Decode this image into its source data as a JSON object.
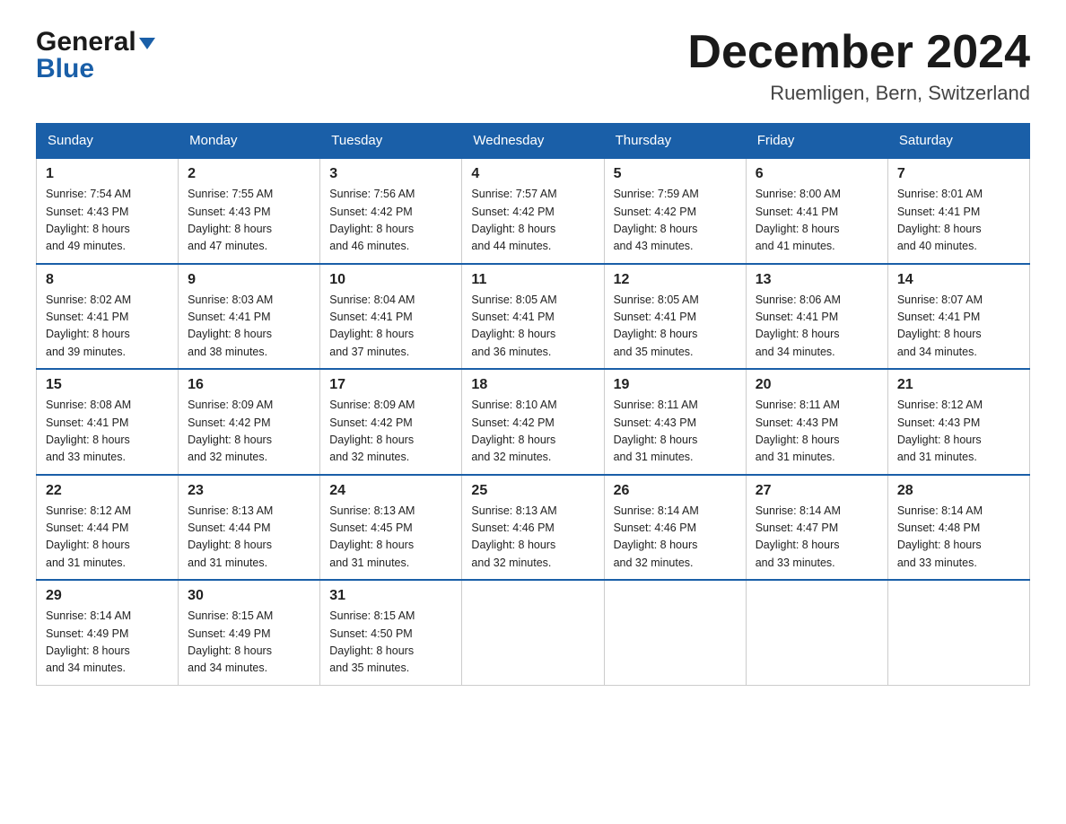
{
  "header": {
    "logo_general": "General",
    "logo_blue": "Blue",
    "month_title": "December 2024",
    "location": "Ruemligen, Bern, Switzerland"
  },
  "days_of_week": [
    "Sunday",
    "Monday",
    "Tuesday",
    "Wednesday",
    "Thursday",
    "Friday",
    "Saturday"
  ],
  "weeks": [
    [
      {
        "day": "1",
        "sunrise": "Sunrise: 7:54 AM",
        "sunset": "Sunset: 4:43 PM",
        "daylight": "Daylight: 8 hours and 49 minutes."
      },
      {
        "day": "2",
        "sunrise": "Sunrise: 7:55 AM",
        "sunset": "Sunset: 4:43 PM",
        "daylight": "Daylight: 8 hours and 47 minutes."
      },
      {
        "day": "3",
        "sunrise": "Sunrise: 7:56 AM",
        "sunset": "Sunset: 4:42 PM",
        "daylight": "Daylight: 8 hours and 46 minutes."
      },
      {
        "day": "4",
        "sunrise": "Sunrise: 7:57 AM",
        "sunset": "Sunset: 4:42 PM",
        "daylight": "Daylight: 8 hours and 44 minutes."
      },
      {
        "day": "5",
        "sunrise": "Sunrise: 7:59 AM",
        "sunset": "Sunset: 4:42 PM",
        "daylight": "Daylight: 8 hours and 43 minutes."
      },
      {
        "day": "6",
        "sunrise": "Sunrise: 8:00 AM",
        "sunset": "Sunset: 4:41 PM",
        "daylight": "Daylight: 8 hours and 41 minutes."
      },
      {
        "day": "7",
        "sunrise": "Sunrise: 8:01 AM",
        "sunset": "Sunset: 4:41 PM",
        "daylight": "Daylight: 8 hours and 40 minutes."
      }
    ],
    [
      {
        "day": "8",
        "sunrise": "Sunrise: 8:02 AM",
        "sunset": "Sunset: 4:41 PM",
        "daylight": "Daylight: 8 hours and 39 minutes."
      },
      {
        "day": "9",
        "sunrise": "Sunrise: 8:03 AM",
        "sunset": "Sunset: 4:41 PM",
        "daylight": "Daylight: 8 hours and 38 minutes."
      },
      {
        "day": "10",
        "sunrise": "Sunrise: 8:04 AM",
        "sunset": "Sunset: 4:41 PM",
        "daylight": "Daylight: 8 hours and 37 minutes."
      },
      {
        "day": "11",
        "sunrise": "Sunrise: 8:05 AM",
        "sunset": "Sunset: 4:41 PM",
        "daylight": "Daylight: 8 hours and 36 minutes."
      },
      {
        "day": "12",
        "sunrise": "Sunrise: 8:05 AM",
        "sunset": "Sunset: 4:41 PM",
        "daylight": "Daylight: 8 hours and 35 minutes."
      },
      {
        "day": "13",
        "sunrise": "Sunrise: 8:06 AM",
        "sunset": "Sunset: 4:41 PM",
        "daylight": "Daylight: 8 hours and 34 minutes."
      },
      {
        "day": "14",
        "sunrise": "Sunrise: 8:07 AM",
        "sunset": "Sunset: 4:41 PM",
        "daylight": "Daylight: 8 hours and 34 minutes."
      }
    ],
    [
      {
        "day": "15",
        "sunrise": "Sunrise: 8:08 AM",
        "sunset": "Sunset: 4:41 PM",
        "daylight": "Daylight: 8 hours and 33 minutes."
      },
      {
        "day": "16",
        "sunrise": "Sunrise: 8:09 AM",
        "sunset": "Sunset: 4:42 PM",
        "daylight": "Daylight: 8 hours and 32 minutes."
      },
      {
        "day": "17",
        "sunrise": "Sunrise: 8:09 AM",
        "sunset": "Sunset: 4:42 PM",
        "daylight": "Daylight: 8 hours and 32 minutes."
      },
      {
        "day": "18",
        "sunrise": "Sunrise: 8:10 AM",
        "sunset": "Sunset: 4:42 PM",
        "daylight": "Daylight: 8 hours and 32 minutes."
      },
      {
        "day": "19",
        "sunrise": "Sunrise: 8:11 AM",
        "sunset": "Sunset: 4:43 PM",
        "daylight": "Daylight: 8 hours and 31 minutes."
      },
      {
        "day": "20",
        "sunrise": "Sunrise: 8:11 AM",
        "sunset": "Sunset: 4:43 PM",
        "daylight": "Daylight: 8 hours and 31 minutes."
      },
      {
        "day": "21",
        "sunrise": "Sunrise: 8:12 AM",
        "sunset": "Sunset: 4:43 PM",
        "daylight": "Daylight: 8 hours and 31 minutes."
      }
    ],
    [
      {
        "day": "22",
        "sunrise": "Sunrise: 8:12 AM",
        "sunset": "Sunset: 4:44 PM",
        "daylight": "Daylight: 8 hours and 31 minutes."
      },
      {
        "day": "23",
        "sunrise": "Sunrise: 8:13 AM",
        "sunset": "Sunset: 4:44 PM",
        "daylight": "Daylight: 8 hours and 31 minutes."
      },
      {
        "day": "24",
        "sunrise": "Sunrise: 8:13 AM",
        "sunset": "Sunset: 4:45 PM",
        "daylight": "Daylight: 8 hours and 31 minutes."
      },
      {
        "day": "25",
        "sunrise": "Sunrise: 8:13 AM",
        "sunset": "Sunset: 4:46 PM",
        "daylight": "Daylight: 8 hours and 32 minutes."
      },
      {
        "day": "26",
        "sunrise": "Sunrise: 8:14 AM",
        "sunset": "Sunset: 4:46 PM",
        "daylight": "Daylight: 8 hours and 32 minutes."
      },
      {
        "day": "27",
        "sunrise": "Sunrise: 8:14 AM",
        "sunset": "Sunset: 4:47 PM",
        "daylight": "Daylight: 8 hours and 33 minutes."
      },
      {
        "day": "28",
        "sunrise": "Sunrise: 8:14 AM",
        "sunset": "Sunset: 4:48 PM",
        "daylight": "Daylight: 8 hours and 33 minutes."
      }
    ],
    [
      {
        "day": "29",
        "sunrise": "Sunrise: 8:14 AM",
        "sunset": "Sunset: 4:49 PM",
        "daylight": "Daylight: 8 hours and 34 minutes."
      },
      {
        "day": "30",
        "sunrise": "Sunrise: 8:15 AM",
        "sunset": "Sunset: 4:49 PM",
        "daylight": "Daylight: 8 hours and 34 minutes."
      },
      {
        "day": "31",
        "sunrise": "Sunrise: 8:15 AM",
        "sunset": "Sunset: 4:50 PM",
        "daylight": "Daylight: 8 hours and 35 minutes."
      },
      null,
      null,
      null,
      null
    ]
  ]
}
